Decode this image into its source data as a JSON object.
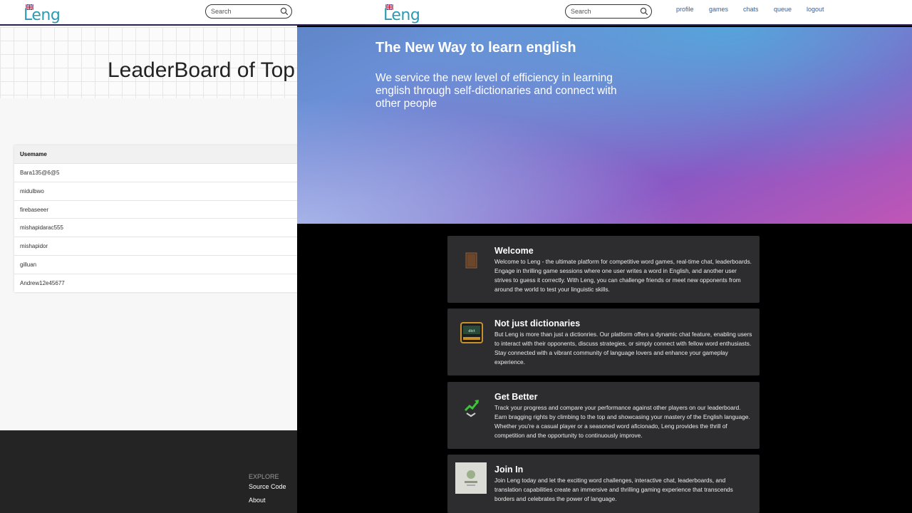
{
  "left_window": {
    "logo_text": "Leng",
    "search_placeholder": "Search",
    "leaderboard_title": "LeaderBoard of Top",
    "table": {
      "header": "Usemame",
      "rows": [
        "Bara135@6@5",
        "midulbwo",
        "firebaseeer",
        "mishapidarac555",
        "mishapidor",
        "gilluan",
        "Andrew12e45677"
      ]
    },
    "footer": {
      "explore": "EXPLORE",
      "source_code": "Source Code",
      "about": "About"
    }
  },
  "right_window": {
    "logo_text": "Leng",
    "search_placeholder": "Search",
    "nav": [
      "profile",
      "games",
      "chats",
      "queue",
      "logout"
    ],
    "hero": {
      "title": "The New Way to learn english",
      "subtitle": "We service the new level of efficiency in learning english through self-dictionaries and connect with other people"
    },
    "cards": [
      {
        "title": "Welcome",
        "text": "Welcome to Leng - the ultimate platform for competitive word games, real-time chat, leaderboards. Engage in thrilling game sessions where one user writes a word in English, and another user strives to guess it correctly. With Leng, you can challenge friends or meet new opponents from around the world to test your linguistic skills."
      },
      {
        "title": "Not just dictionaries",
        "text": "But Leng is more than just a dictionries. Our platform offers a dynamic chat feature, enabling users to interact with their opponents, discuss strategies, or simply connect with fellow word enthusiasts. Stay connected with a vibrant community of language lovers and enhance your gameplay experience."
      },
      {
        "title": "Get Better",
        "text": "Track your progress and compare your performance against other players on our leaderboard. Earn bragging rights by climbing to the top and showcasing your mastery of the English language. Whether you're a casual player or a seasoned word aficionado, Leng provides the thrill of competition and the opportunity to continuously improve."
      },
      {
        "title": "Join In",
        "text": "Join Leng today and let the exciting word challenges, interactive chat, leaderboards, and translation capabilities create an immersive and thrilling gaming experience that transcends borders and celebrates the power of language."
      }
    ]
  },
  "colors": {
    "header_border": "#2b2250",
    "logo": "#2a9bb5",
    "nav_link": "#2f62a8",
    "card_bg": "#2d2c2e",
    "footer_bg": "#242424"
  }
}
